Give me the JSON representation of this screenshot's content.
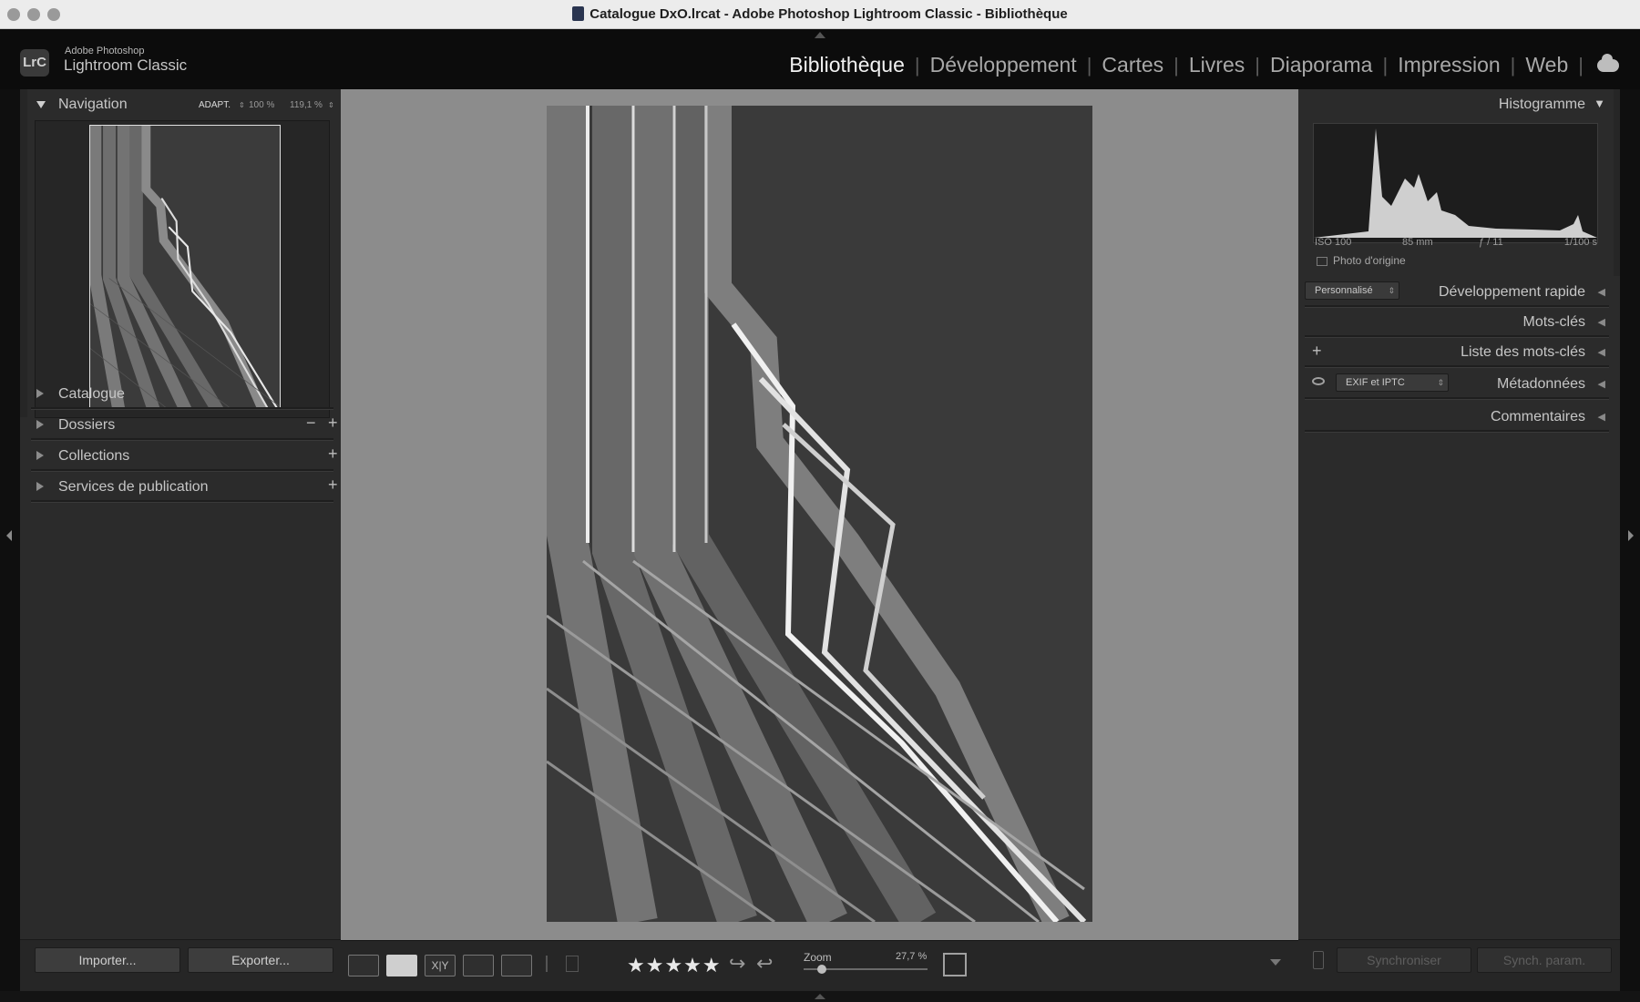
{
  "window": {
    "title": "Catalogue DxO.lrcat - Adobe Photoshop Lightroom Classic - Bibliothèque"
  },
  "brand": {
    "badge": "LrC",
    "small": "Adobe Photoshop",
    "big": "Lightroom Classic"
  },
  "modules": [
    {
      "label": "Bibliothèque",
      "active": true
    },
    {
      "label": "Développement"
    },
    {
      "label": "Cartes"
    },
    {
      "label": "Livres"
    },
    {
      "label": "Diaporama"
    },
    {
      "label": "Impression"
    },
    {
      "label": "Web"
    }
  ],
  "left": {
    "navigation": {
      "title": "Navigation",
      "fit": "ADAPT.",
      "zoom1": "100 %",
      "zoom2": "119,1 %"
    },
    "panels": [
      "Catalogue",
      "Dossiers",
      "Collections",
      "Services de publication"
    ],
    "import_label": "Importer...",
    "export_label": "Exporter..."
  },
  "toolbar": {
    "rating": "★★★★★",
    "zoom_label": "Zoom",
    "zoom_value": "27,7 %",
    "zoom_level": 0.15
  },
  "right": {
    "histogram": {
      "title": "Histogramme",
      "iso": "ISO 100",
      "focal": "85 mm",
      "aperture": "ƒ / 11",
      "shutter": "1/100 s",
      "original_label": "Photo d'origine"
    },
    "quick_develop": {
      "title": "Développement rapide",
      "preset": "Personnalisé"
    },
    "keywords": {
      "title": "Mots-clés"
    },
    "keyword_list": {
      "title": "Liste des mots-clés"
    },
    "metadata": {
      "title": "Métadonnées",
      "preset": "EXIF et IPTC"
    },
    "comments": {
      "title": "Commentaires"
    },
    "sync_label": "Synchroniser",
    "sync_settings_label": "Synch. param."
  },
  "colors": {
    "module_active": "#f2f2f2",
    "panel_bg": "#2b2b2b",
    "preview_bg": "#8c8c8c"
  }
}
